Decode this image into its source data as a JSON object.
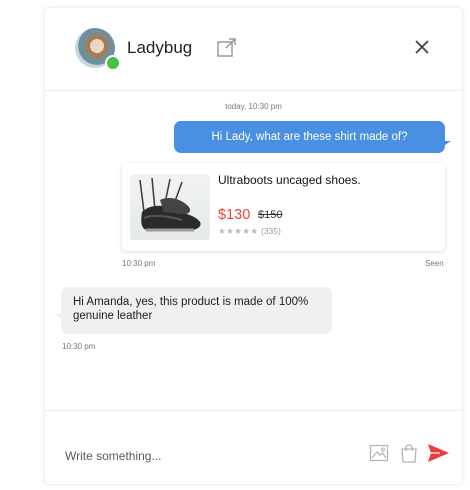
{
  "header": {
    "contact_name": "Ladybug",
    "status": "online",
    "icons": {
      "external": "external-link-icon",
      "close": "close-icon"
    }
  },
  "conversation": {
    "date_label": "today, 10:30 pm",
    "outgoing": {
      "text": "Hi Lady, what are these shirt made of?",
      "time": "10:30 pm",
      "receipt": "Seen"
    },
    "product": {
      "title": "Ultraboots uncaged shoes.",
      "price": "$130",
      "old_price": "$150",
      "stars": "★★★★★",
      "reviews": "(335)"
    },
    "incoming": {
      "text": "Hi Amanda, yes, this product is made of 100% genuine leather",
      "time": "10:30 pm"
    }
  },
  "composer": {
    "placeholder": "Write something...",
    "icons": {
      "image": "image-icon",
      "shop": "shopping-bag-icon",
      "send": "send-icon"
    }
  },
  "colors": {
    "accent_blue": "#4a90e2",
    "price_red": "#e8453c",
    "send_red": "#f03b3b",
    "online_green": "#46c24a",
    "incoming_bubble": "#f0f0f0"
  }
}
